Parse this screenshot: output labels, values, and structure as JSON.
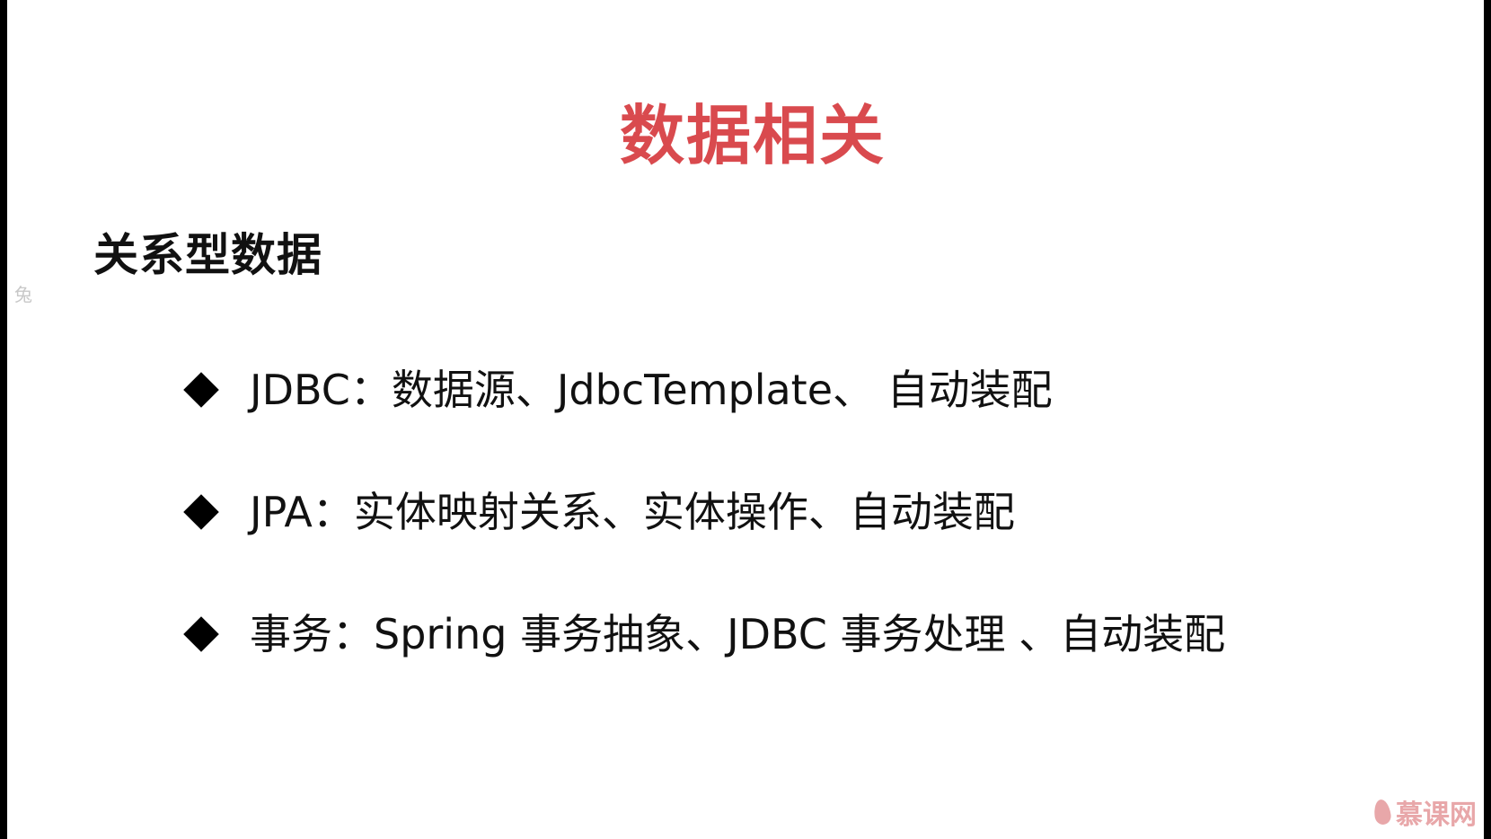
{
  "slide": {
    "title": "数据相关",
    "subtitle": "关系型数据",
    "side_mark": "兔",
    "bullets": [
      "JDBC：数据源、JdbcTemplate、 自动装配",
      "JPA：实体映射关系、实体操作、自动装配",
      "事务：Spring 事务抽象、JDBC 事务处理 、自动装配"
    ]
  },
  "watermark": {
    "text": "慕课网",
    "icon": "flame-icon"
  },
  "colors": {
    "title": "#d94a4e",
    "text": "#111111",
    "background": "#ffffff",
    "frame": "#000000",
    "watermark": "#e8a7a9"
  }
}
